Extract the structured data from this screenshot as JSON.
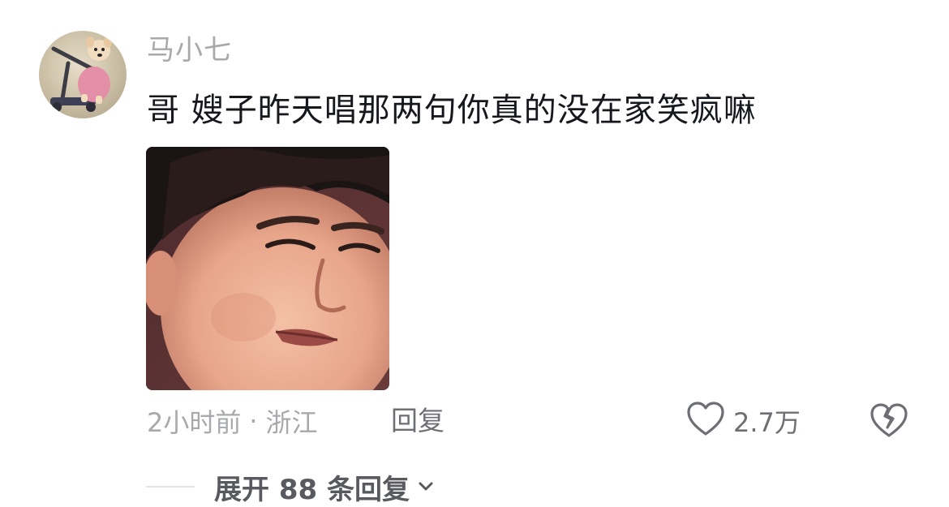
{
  "comment": {
    "author": "马小七",
    "text": "哥 嫂子昨天唱那两句你真的没在家笑疯嘛",
    "time": "2小时前",
    "separator": "·",
    "location": "浙江",
    "reply_label": "回复",
    "like_count": "2.7万",
    "expand_replies_label": "展开 88 条回复"
  },
  "icons": {
    "like": "heart-outline-icon",
    "dislike": "broken-heart-icon",
    "expand": "chevron-down-icon"
  },
  "colors": {
    "text_primary": "#16181d",
    "text_secondary": "#a7a9ad",
    "text_action": "#6d6f74"
  }
}
